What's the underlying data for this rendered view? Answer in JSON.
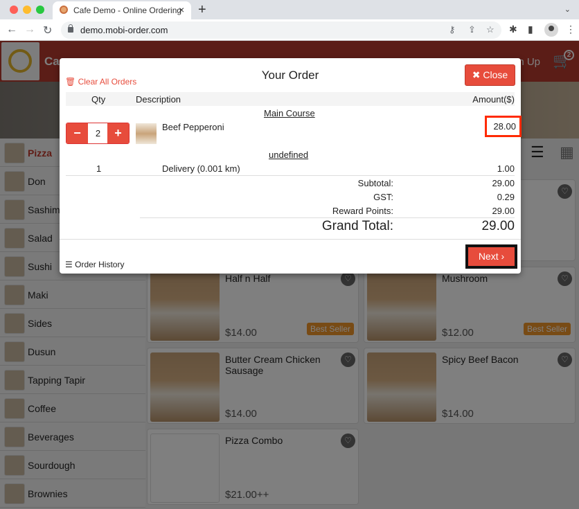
{
  "browser": {
    "tab_title": "Cafe Demo - Online Ordering",
    "tab_close": "×",
    "new_tab": "+",
    "url": "demo.mobi-order.com",
    "menu_glyph": "⋮"
  },
  "header": {
    "brand": "Ca",
    "sign_up": "gn Up",
    "cart_count": "2"
  },
  "sidebar": {
    "categories": [
      {
        "label": "Pizza",
        "active": true
      },
      {
        "label": "Don"
      },
      {
        "label": "Sashimi"
      },
      {
        "label": "Salad"
      },
      {
        "label": "Sushi"
      },
      {
        "label": "Maki"
      },
      {
        "label": "Sides"
      },
      {
        "label": "Dusun"
      },
      {
        "label": "Tapping Tapir"
      },
      {
        "label": "Coffee"
      },
      {
        "label": "Beverages"
      },
      {
        "label": "Sourdough"
      },
      {
        "label": "Brownies"
      }
    ]
  },
  "products": [
    {
      "name": "Half n Half",
      "price": "$14.00",
      "badge": "Best Seller"
    },
    {
      "name": "Mushroom",
      "price": "$12.00",
      "badge": "Best Seller"
    },
    {
      "name": "Butter Cream Chicken Sausage",
      "price": "$14.00"
    },
    {
      "name": "Spicy Beef Bacon",
      "price": "$14.00"
    },
    {
      "name": "Pizza Combo",
      "price": "$21.00++"
    }
  ],
  "modal": {
    "title": "Your Order",
    "clear_all": "Clear All Orders",
    "close_label": "Close",
    "columns": {
      "qty": "Qty",
      "description": "Description",
      "amount": "Amount($)"
    },
    "sections": [
      {
        "title": "Main Course",
        "items": [
          {
            "qty": "2",
            "name": "Beef Pepperoni",
            "amount": "28.00"
          }
        ]
      },
      {
        "title": "undefined",
        "items": [
          {
            "qty": "1",
            "name": "Delivery (0.001 km)",
            "amount": "1.00"
          }
        ]
      }
    ],
    "totals": {
      "subtotal_label": "Subtotal:",
      "subtotal": "29.00",
      "gst_label": "GST:",
      "gst": "0.29",
      "reward_label": "Reward Points:",
      "reward": "29.00",
      "grand_label": "Grand Total:",
      "grand": "29.00"
    },
    "order_history": "Order History",
    "next_label": "Next",
    "stepper": {
      "minus": "−",
      "plus": "+"
    }
  },
  "colors": {
    "accent": "#e74c3c",
    "header": "#b73a2f",
    "best_seller": "#f0962b"
  }
}
